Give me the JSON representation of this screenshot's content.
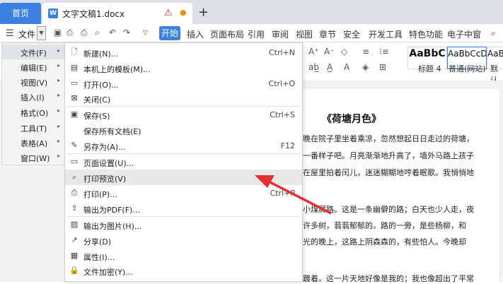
{
  "tabs": {
    "home": "首页",
    "doc": "文字文稿1.docx",
    "new_tab": "+"
  },
  "ribbon": {
    "file": "文件",
    "start": "开始",
    "tabs": [
      "插入",
      "页面布局",
      "引用",
      "审阅",
      "视图",
      "章节",
      "安全",
      "开发工具",
      "特色功能",
      "电子中窗"
    ]
  },
  "styles": [
    {
      "sample": "AaBbC",
      "label": "标题 4"
    },
    {
      "sample": "AaBbCcDd",
      "label": "普通(网站)"
    },
    {
      "sample": "AaBb",
      "label": "默认"
    }
  ],
  "left_menu": [
    {
      "label": "文件(F)"
    },
    {
      "label": "编辑(E)"
    },
    {
      "label": "视图(V)"
    },
    {
      "label": "插入(I)"
    },
    {
      "label": "格式(O)"
    },
    {
      "label": "工具(T)"
    },
    {
      "label": "表格(A)"
    },
    {
      "label": "窗口(W)"
    }
  ],
  "sub_menu": [
    {
      "label": "新建(N)...",
      "shortcut": "Ctrl+N",
      "icon": "new-doc-icon"
    },
    {
      "label": "本机上的模板(M)...",
      "shortcut": "",
      "icon": "template-icon"
    },
    {
      "label": "打开(O)...",
      "shortcut": "Ctrl+O",
      "icon": "folder-icon"
    },
    {
      "label": "关闭(C)",
      "shortcut": "",
      "icon": "close-doc-icon"
    },
    {
      "label": "保存(S)",
      "shortcut": "Ctrl+S",
      "icon": "save-icon"
    },
    {
      "label": "保存所有文档(E)",
      "shortcut": "",
      "icon": ""
    },
    {
      "label": "另存为(A)...",
      "shortcut": "F12",
      "icon": "save-as-icon"
    },
    {
      "label": "页面设置(U)...",
      "shortcut": "",
      "icon": "page-setup-icon"
    },
    {
      "label": "打印预览(V)",
      "shortcut": "",
      "icon": "print-preview-icon"
    },
    {
      "label": "打印(P)...",
      "shortcut": "Ctrl+P",
      "icon": "print-icon"
    },
    {
      "label": "输出为PDF(F)...",
      "shortcut": "",
      "icon": "pdf-icon"
    },
    {
      "label": "输出为图片(H)...",
      "shortcut": "",
      "icon": "image-icon"
    },
    {
      "label": "分享(D)",
      "shortcut": "",
      "icon": "share-icon"
    },
    {
      "label": "属性(I)...",
      "shortcut": "",
      "icon": "properties-icon"
    },
    {
      "label": "文件加密(Y)...",
      "shortcut": "",
      "icon": "encrypt-icon"
    }
  ],
  "document": {
    "title": "《荷塘月色》",
    "lines": [
      "晚在院子里坐着乘凉，忽然想起日日走过的荷塘，",
      "一番样子吧。月亮渐渐地升高了，墙外马路上孩子",
      "在屋里拍着闰儿，迷迷糊糊地哼着眠歌。我悄悄地",
      "小煤屑路。这是一条幽僻的路；白天也少人走，夜",
      "许多树，蓊蓊郁郁的。路的一旁，是些杨柳，和",
      "光的晚上，这路上阴森森的，有些怕人。今晚却",
      "踱着。这一片天地好像是我的；我也像超出了平常"
    ]
  }
}
